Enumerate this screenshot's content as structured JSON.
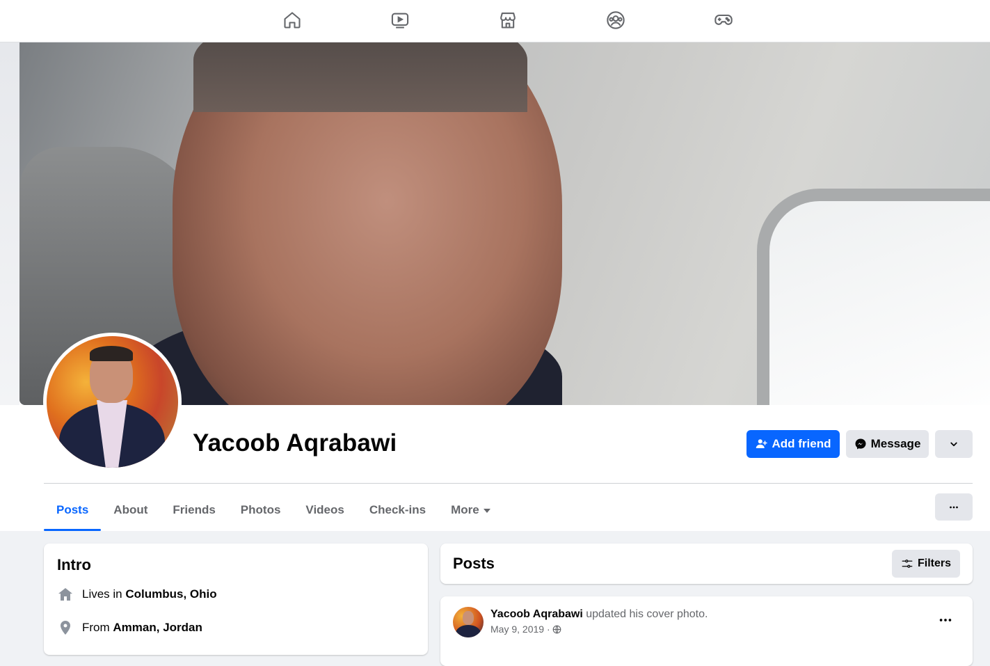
{
  "topnav": {
    "icons": [
      "home-icon",
      "video-icon",
      "marketplace-icon",
      "groups-icon",
      "gaming-icon"
    ]
  },
  "profile": {
    "name": "Yacoob Aqrabawi",
    "actions": {
      "add_friend": "Add friend",
      "message": "Message"
    }
  },
  "tabs": [
    {
      "label": "Posts",
      "active": true
    },
    {
      "label": "About"
    },
    {
      "label": "Friends"
    },
    {
      "label": "Photos"
    },
    {
      "label": "Videos"
    },
    {
      "label": "Check-ins"
    },
    {
      "label": "More"
    }
  ],
  "intro": {
    "title": "Intro",
    "lives_prefix": "Lives in",
    "lives_place": "Columbus, Ohio",
    "from_prefix": "From",
    "from_place": "Amman, Jordan"
  },
  "posts": {
    "title": "Posts",
    "filters_label": "Filters",
    "items": [
      {
        "author": "Yacoob Aqrabawi",
        "action": "updated his cover photo.",
        "date": "May 9, 2019 ·"
      }
    ]
  },
  "colors": {
    "accent": "#0866ff",
    "secondary_button": "#e4e6eb",
    "page_bg": "#f0f2f5",
    "muted_text": "#65676b"
  }
}
